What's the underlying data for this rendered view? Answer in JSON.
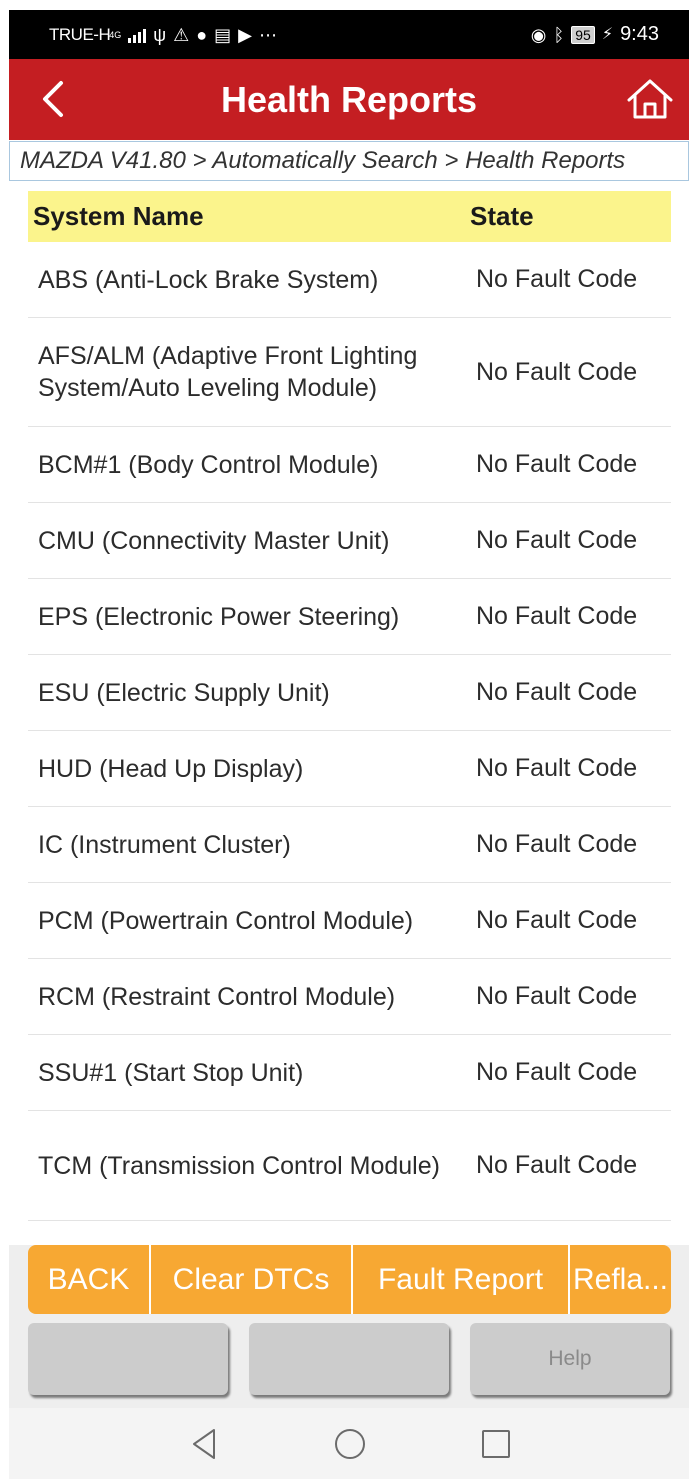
{
  "status_bar": {
    "carrier": "TRUE-H",
    "network": "4G",
    "battery": "95",
    "time": "9:43"
  },
  "header": {
    "title": "Health Reports",
    "back_icon": "chevron-left-icon",
    "home_icon": "home-icon"
  },
  "breadcrumb": "MAZDA V41.80 > Automatically Search > Health Reports",
  "table": {
    "columns": [
      "System Name",
      "State"
    ],
    "rows": [
      {
        "name": "ABS (Anti-Lock Brake System)",
        "state": "No Fault Code"
      },
      {
        "name": "AFS/ALM (Adaptive Front Lighting System/Auto Leveling Module)",
        "state": "No Fault Code"
      },
      {
        "name": "BCM#1 (Body Control Module)",
        "state": "No Fault Code"
      },
      {
        "name": "CMU (Connectivity Master Unit)",
        "state": "No Fault Code"
      },
      {
        "name": "EPS (Electronic Power Steering)",
        "state": "No Fault Code"
      },
      {
        "name": "ESU (Electric Supply Unit)",
        "state": "No Fault Code"
      },
      {
        "name": "HUD (Head Up Display)",
        "state": "No Fault Code"
      },
      {
        "name": "IC (Instrument Cluster)",
        "state": "No Fault Code"
      },
      {
        "name": "PCM (Powertrain Control Module)",
        "state": "No Fault Code"
      },
      {
        "name": "RCM (Restraint Control Module)",
        "state": "No Fault Code"
      },
      {
        "name": "SSU#1 (Start Stop Unit)",
        "state": "No Fault Code"
      },
      {
        "name": "TCM (Transmission Control Module)",
        "state": "No Fault Code"
      }
    ]
  },
  "actions": {
    "back": "BACK",
    "clear_dtcs": "Clear DTCs",
    "fault_report": "Fault Report",
    "reflash": "Refla...",
    "help": "Help"
  },
  "nav": [
    "back-triangle-icon",
    "home-circle-icon",
    "recents-square-icon"
  ],
  "colors": {
    "title_bar": "#c41e22",
    "header_row": "#fbf48c",
    "action_buttons": "#f7a833"
  }
}
